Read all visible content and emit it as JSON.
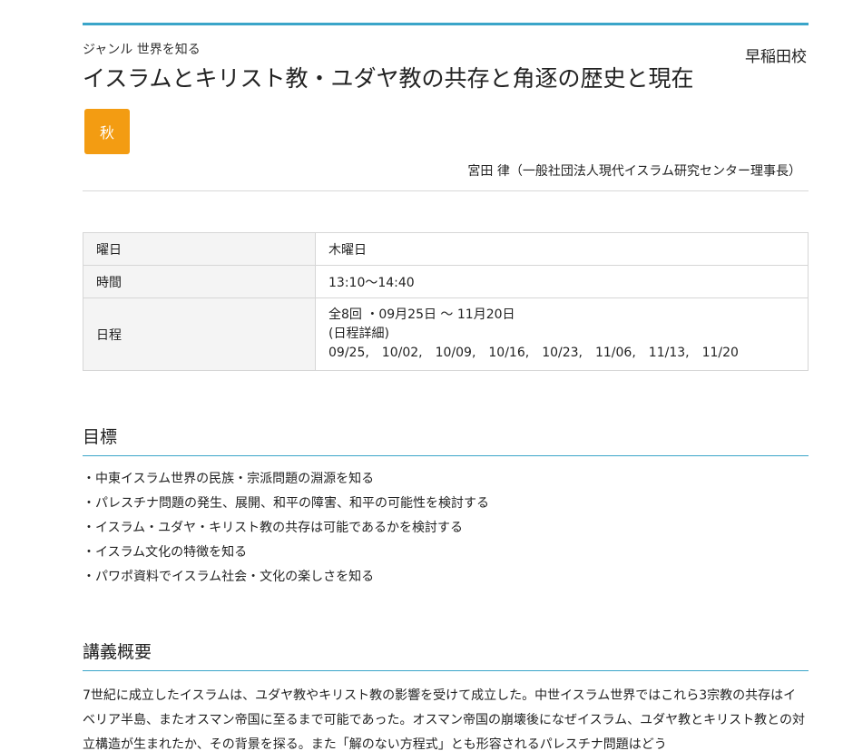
{
  "header": {
    "genre": "ジャンル 世界を知る",
    "school": "早稲田校",
    "title": "イスラムとキリスト教・ユダヤ教の共存と角逐の歴史と現在",
    "season": "秋",
    "instructor": "宮田 律（一般社団法人現代イスラム研究センター理事長）"
  },
  "info": {
    "day_label": "曜日",
    "day_value": "木曜日",
    "time_label": "時間",
    "time_value": "13:10～14:40",
    "schedule_label": "日程",
    "schedule_summary": "全8回 ・09月25日 ～ 11月20日",
    "schedule_detail": "(日程詳細)",
    "dates": [
      "09/25,",
      "10/02,",
      "10/09,",
      "10/16,",
      "10/23,",
      "11/06,",
      "11/13,",
      "11/20"
    ]
  },
  "goals": {
    "heading": "目標",
    "items": [
      "・中東イスラム世界の民族・宗派問題の淵源を知る",
      "・パレスチナ問題の発生、展開、和平の障害、和平の可能性を検討する",
      "・イスラム・ユダヤ・キリスト教の共存は可能であるかを検討する",
      "・イスラム文化の特徴を知る",
      "・パワポ資料でイスラム社会・文化の楽しさを知る"
    ]
  },
  "overview": {
    "heading": "講義概要",
    "text": "7世紀に成立したイスラムは、ユダヤ教やキリスト教の影響を受けて成立した。中世イスラム世界ではこれら3宗教の共存はイベリア半島、またオスマン帝国に至るまで可能であった。オスマン帝国の崩壊後になぜイスラム、ユダヤ教とキリスト教との対立構造が生まれたか、その背景を探る。また「解のない方程式」とも形容されるパレスチナ問題はどう"
  },
  "colors": {
    "accent": "#3aa5c9",
    "season_badge": "#f39c12"
  }
}
